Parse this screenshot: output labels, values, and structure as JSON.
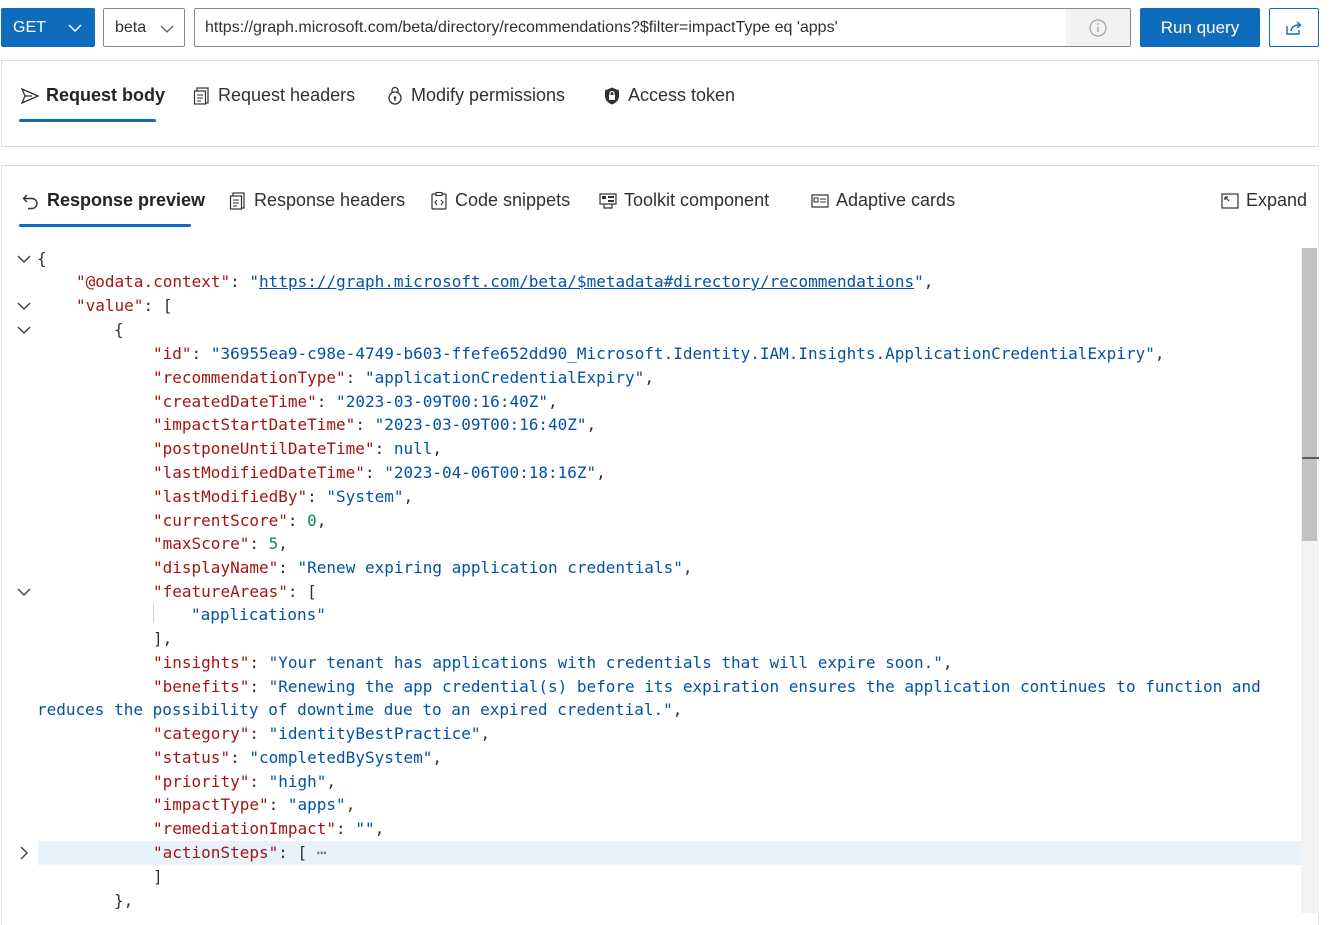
{
  "query": {
    "method": "GET",
    "version": "beta",
    "url": "https://graph.microsoft.com/beta/directory/recommendations?$filter=impactType eq 'apps'",
    "run_label": "Run query"
  },
  "request_tabs": [
    {
      "label": "Request body",
      "icon": "send-icon",
      "selected": true
    },
    {
      "label": "Request headers",
      "icon": "document-header-icon",
      "selected": false
    },
    {
      "label": "Modify permissions",
      "icon": "permission-lock-icon",
      "selected": false
    },
    {
      "label": "Access token",
      "icon": "shield-lock-icon",
      "selected": false
    }
  ],
  "response_tabs": [
    {
      "label": "Response preview",
      "icon": "undo-arrow-icon",
      "selected": true
    },
    {
      "label": "Response headers",
      "icon": "document-header-icon",
      "selected": false
    },
    {
      "label": "Code snippets",
      "icon": "code-clipboard-icon",
      "selected": false
    },
    {
      "label": "Toolkit component",
      "icon": "toolkit-icon",
      "selected": false
    },
    {
      "label": "Adaptive cards",
      "icon": "card-icon",
      "selected": false
    }
  ],
  "expand_label": "Expand",
  "response": {
    "odata_context_key": "@odata.context",
    "odata_context_value": "https://graph.microsoft.com/beta/$metadata#directory/recommendations",
    "value_key": "value",
    "fields": [
      {
        "key": "id",
        "value": "36955ea9-c98e-4749-b603-ffefe652dd90_Microsoft.Identity.IAM.Insights.ApplicationCredentialExpiry",
        "type": "string"
      },
      {
        "key": "recommendationType",
        "value": "applicationCredentialExpiry",
        "type": "string"
      },
      {
        "key": "createdDateTime",
        "value": "2023-03-09T00:16:40Z",
        "type": "string"
      },
      {
        "key": "impactStartDateTime",
        "value": "2023-03-09T00:16:40Z",
        "type": "string"
      },
      {
        "key": "postponeUntilDateTime",
        "value": "null",
        "type": "literal"
      },
      {
        "key": "lastModifiedDateTime",
        "value": "2023-04-06T00:18:16Z",
        "type": "string"
      },
      {
        "key": "lastModifiedBy",
        "value": "System",
        "type": "string"
      },
      {
        "key": "currentScore",
        "value": "0",
        "type": "number"
      },
      {
        "key": "maxScore",
        "value": "5",
        "type": "number"
      },
      {
        "key": "displayName",
        "value": "Renew expiring application credentials",
        "type": "string"
      }
    ],
    "feature_areas_key": "featureAreas",
    "feature_areas": [
      "applications"
    ],
    "insights_key": "insights",
    "insights_value": "Your tenant has applications with credentials that will expire soon.",
    "benefits_key": "benefits",
    "benefits_value_line1": "Renewing the app credential(s) before its expiration ensures the application continues to function and",
    "benefits_value_line2": "reduces the possibility of downtime due to an expired credential.",
    "fields2": [
      {
        "key": "category",
        "value": "identityBestPractice"
      },
      {
        "key": "status",
        "value": "completedBySystem"
      },
      {
        "key": "priority",
        "value": "high"
      },
      {
        "key": "impactType",
        "value": "apps"
      },
      {
        "key": "remediationImpact",
        "value": ""
      }
    ],
    "action_steps_key": "actionSteps"
  },
  "colors": {
    "accent": "#0f6cbd",
    "json_key": "#a31515",
    "json_string": "#0451a5",
    "json_number": "#098658"
  }
}
